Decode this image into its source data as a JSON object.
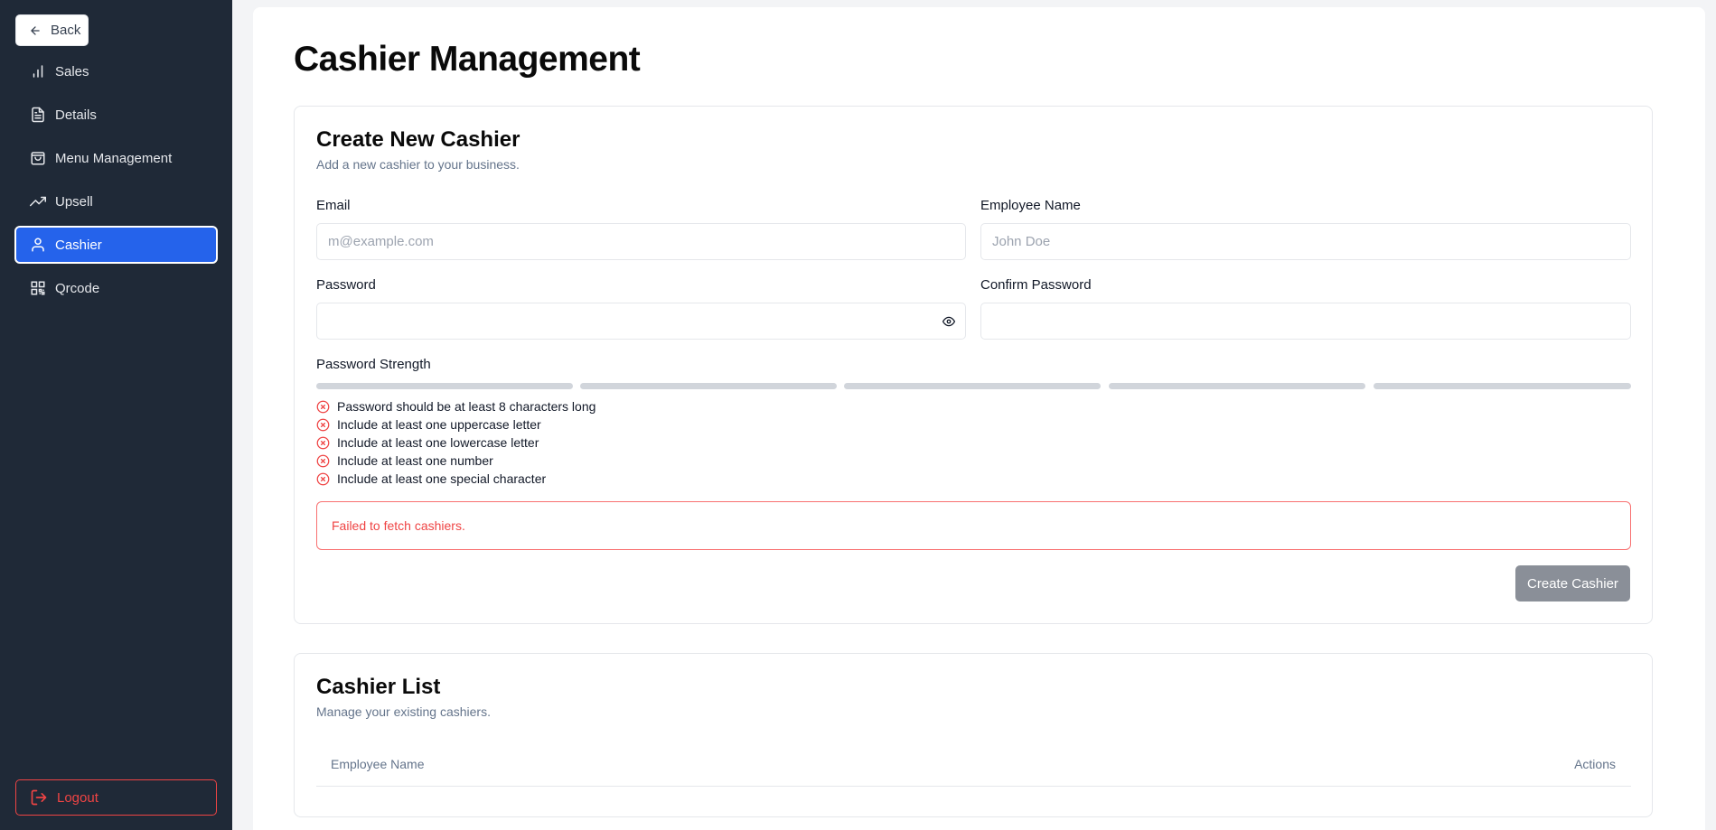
{
  "sidebar": {
    "back_label": "Back",
    "items": [
      {
        "label": "Sales",
        "icon": "bar-chart-icon"
      },
      {
        "label": "Details",
        "icon": "document-icon"
      },
      {
        "label": "Menu Management",
        "icon": "shopping-bag-icon"
      },
      {
        "label": "Upsell",
        "icon": "trending-up-icon"
      },
      {
        "label": "Cashier",
        "icon": "user-icon",
        "active": true
      },
      {
        "label": "Qrcode",
        "icon": "qrcode-icon"
      }
    ],
    "logout_label": "Logout"
  },
  "page": {
    "title": "Cashier Management"
  },
  "create_card": {
    "title": "Create New Cashier",
    "subtitle": "Add a new cashier to your business.",
    "email_label": "Email",
    "email_placeholder": "m@example.com",
    "name_label": "Employee Name",
    "name_placeholder": "John Doe",
    "password_label": "Password",
    "confirm_label": "Confirm Password",
    "strength_label": "Password Strength",
    "strength_level": 0,
    "requirements": [
      "Password should be at least 8 characters long",
      "Include at least one uppercase letter",
      "Include at least one lowercase letter",
      "Include at least one number",
      "Include at least one special character"
    ],
    "error": "Failed to fetch cashiers.",
    "submit_label": "Create Cashier"
  },
  "list_card": {
    "title": "Cashier List",
    "subtitle": "Manage your existing cashiers.",
    "columns": [
      "Employee Name",
      "Actions"
    ]
  },
  "colors": {
    "sidebar_bg": "#1f2937",
    "active": "#2563eb",
    "error": "#ef4444",
    "disabled_button": "#8a8f98"
  }
}
